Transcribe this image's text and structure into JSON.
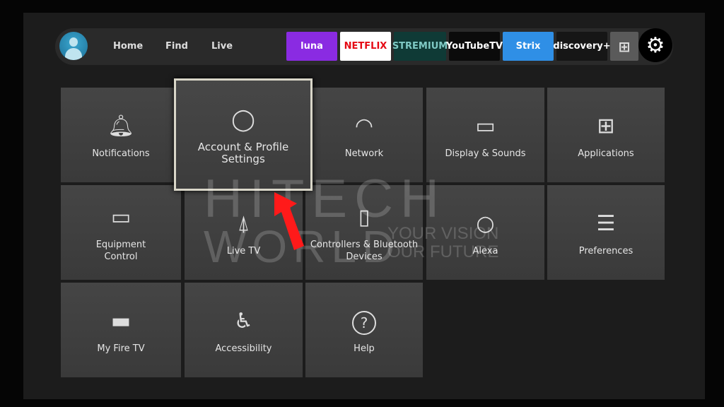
{
  "topbar": {
    "nav": [
      "Home",
      "Find",
      "Live"
    ],
    "apps": [
      {
        "label": "luna",
        "bg": "#8a2be2",
        "fg": "#ffffff"
      },
      {
        "label": "NETFLIX",
        "bg": "#ffffff",
        "fg": "#e50914"
      },
      {
        "label": "STREMIUM",
        "bg": "#0f3a36",
        "fg": "#7fc9c4"
      },
      {
        "label": "YouTubeTV",
        "bg": "#0b0b0b",
        "fg": "#ffffff"
      },
      {
        "label": "Strix",
        "bg": "#2f8fe6",
        "fg": "#ffffff"
      },
      {
        "label": "discovery+",
        "bg": "#161616",
        "fg": "#ffffff"
      }
    ]
  },
  "tiles": [
    {
      "label": "Notifications",
      "icon": "bell-icon"
    },
    {
      "label": "Account & Profile\nSettings",
      "icon": "user-icon",
      "focused": true
    },
    {
      "label": "Network",
      "icon": "wifi-icon"
    },
    {
      "label": "Display & Sounds",
      "icon": "display-icon"
    },
    {
      "label": "Applications",
      "icon": "apps-icon"
    },
    {
      "label": "Equipment\nControl",
      "icon": "tv-icon"
    },
    {
      "label": "Live TV",
      "icon": "antenna-icon"
    },
    {
      "label": "Controllers & Bluetooth\nDevices",
      "icon": "remote-icon"
    },
    {
      "label": "Alexa",
      "icon": "alexa-icon"
    },
    {
      "label": "Preferences",
      "icon": "sliders-icon"
    },
    {
      "label": "My Fire TV",
      "icon": "firetv-stick-icon"
    },
    {
      "label": "Accessibility",
      "icon": "accessibility-icon"
    },
    {
      "label": "Help",
      "icon": "help-icon"
    }
  ],
  "watermark": {
    "line1": "HITECH",
    "line2": "WORLD",
    "tag1": "YOUR VISION",
    "tag2": "OUR FUTURE"
  },
  "colors": {
    "focus_border": "#d9d6c8",
    "arrow": "#ff1a1a"
  }
}
